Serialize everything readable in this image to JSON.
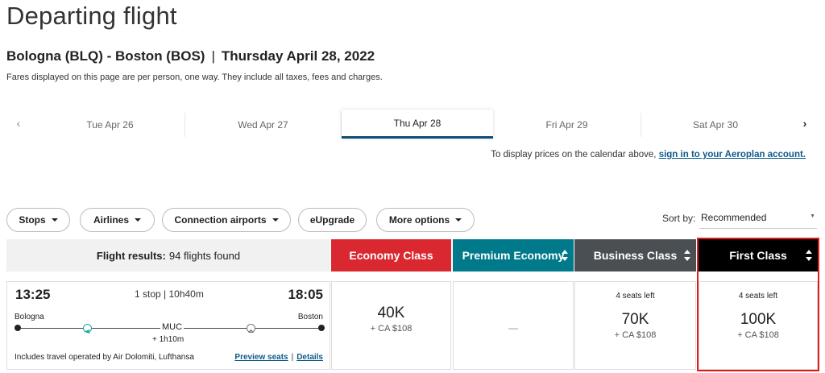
{
  "page": {
    "title": "Departing flight",
    "route": "Bologna (BLQ) - Boston (BOS)",
    "separator": "|",
    "date": "Thursday April 28, 2022",
    "fare_note": "Fares displayed on this page are per person, one way. They include all taxes, fees and charges."
  },
  "date_tabs": [
    {
      "label": "Tue Apr 26"
    },
    {
      "label": "Wed Apr 27"
    },
    {
      "label": "Thu Apr 28",
      "active": true
    },
    {
      "label": "Fri Apr 29"
    },
    {
      "label": "Sat Apr 30"
    }
  ],
  "nav": {
    "prev_icon": "‹",
    "next_icon": "›"
  },
  "aeroplan": {
    "text": "To display prices on the calendar above, ",
    "link": "sign in to your Aeroplan account."
  },
  "filters": {
    "stops": "Stops",
    "airlines": "Airlines",
    "connection_airports": "Connection airports",
    "eupgrade": "eUpgrade",
    "more_options": "More options"
  },
  "sort": {
    "label": "Sort by:",
    "value": "Recommended"
  },
  "results": {
    "label": "Flight results:",
    "count": "94 flights found"
  },
  "cabins": [
    {
      "label": "Economy Class",
      "color": "#d9282f"
    },
    {
      "label": "Premium Economy",
      "color": "#00798a"
    },
    {
      "label": "Business Class",
      "color": "#4a4f54"
    },
    {
      "label": "First Class",
      "color": "#000000"
    }
  ],
  "flight": {
    "depart_time": "13:25",
    "arrive_time": "18:05",
    "summary": "1 stop | 10h40m",
    "origin": "Bologna",
    "destination": "Boston",
    "connection": "MUC",
    "layover": "+ 1h10m",
    "operated_by": "Includes travel operated by Air Dolomiti, Lufthansa",
    "preview_seats": "Preview seats",
    "link_separator": "|",
    "details": "Details"
  },
  "fares": {
    "economy": {
      "points": "40K",
      "cash": "+ CA $108"
    },
    "premium": {
      "unavailable": "—"
    },
    "business": {
      "seats": "4 seats left",
      "points": "70K",
      "cash": "+ CA $108"
    },
    "first": {
      "seats": "4 seats left",
      "points": "100K",
      "cash": "+ CA $108"
    }
  }
}
